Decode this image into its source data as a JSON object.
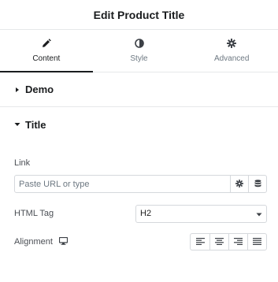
{
  "header": {
    "title": "Edit Product Title"
  },
  "tabs": [
    {
      "label": "Content",
      "icon": "pencil-icon",
      "active": true
    },
    {
      "label": "Style",
      "icon": "contrast-icon",
      "active": false
    },
    {
      "label": "Advanced",
      "icon": "gear-icon",
      "active": false
    }
  ],
  "sections": {
    "demo": {
      "label": "Demo",
      "expanded": false
    },
    "title": {
      "label": "Title",
      "expanded": true
    }
  },
  "fields": {
    "link": {
      "label": "Link",
      "value": "",
      "placeholder": "Paste URL or type"
    },
    "html_tag": {
      "label": "HTML Tag",
      "selected": "H2"
    },
    "alignment": {
      "label": "Alignment",
      "options": [
        "left",
        "center",
        "right",
        "justify"
      ]
    }
  },
  "colors": {
    "text": "#1a1c1e",
    "muted": "#6d7882",
    "border": "#d5d8dc"
  }
}
